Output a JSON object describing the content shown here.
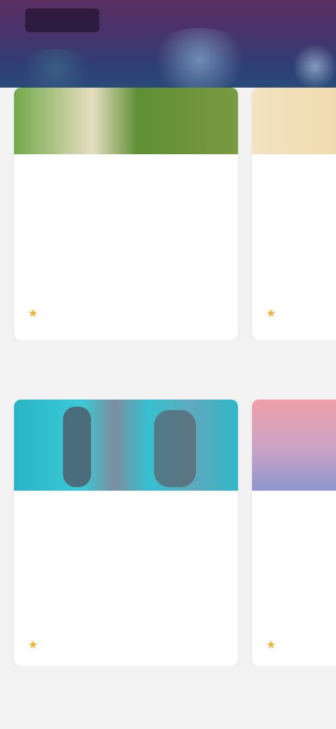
{
  "hero": {
    "brand": "",
    "link": ""
  },
  "row1": {
    "cards": [
      {
        "title": "",
        "desc": "",
        "meta": "",
        "icon": "star-icon"
      },
      {
        "title": "",
        "desc": "",
        "meta": "",
        "icon": "star-icon"
      }
    ]
  },
  "section": {
    "title": ""
  },
  "row2": {
    "cards": [
      {
        "title": "",
        "desc": "",
        "meta": "",
        "icon": "star-icon"
      },
      {
        "title": "",
        "desc": "",
        "meta": "",
        "icon": "star-icon"
      }
    ]
  },
  "colors": {
    "hero_top": "#5b2f63",
    "hero_bottom": "#2a4a78",
    "accent_star": "#f2b233",
    "background": "#f3f3f4"
  }
}
